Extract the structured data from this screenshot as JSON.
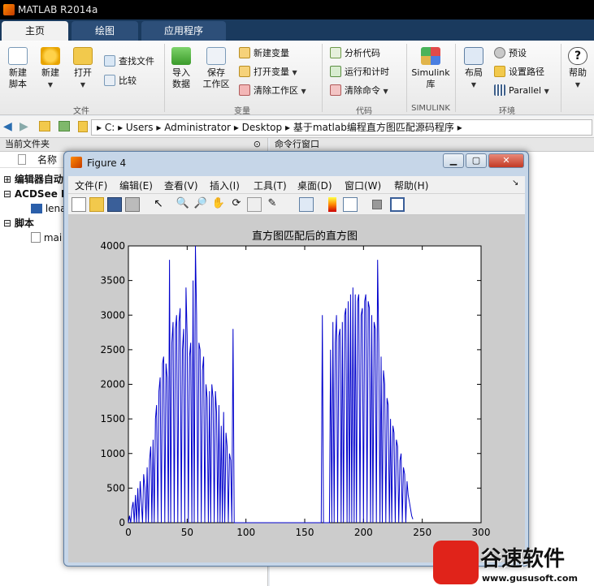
{
  "app": {
    "title": "MATLAB R2014a"
  },
  "tabs": [
    {
      "label": "主页"
    },
    {
      "label": "绘图"
    },
    {
      "label": "应用程序"
    }
  ],
  "ribbon": {
    "new_script": [
      "新建",
      "脚本"
    ],
    "new": "新建",
    "open": "打开",
    "find_files": "查找文件",
    "compare": "比较",
    "import_data": [
      "导入",
      "数据"
    ],
    "save_workspace": [
      "保存",
      "工作区"
    ],
    "new_variable": "新建变量",
    "open_variable": "打开变量",
    "clear_workspace": "清除工作区",
    "analyze_code": "分析代码",
    "run_and_time": "运行和计时",
    "clear_commands": "清除命令",
    "simulink": [
      "Simulink",
      "库"
    ],
    "layout": "布局",
    "preferences": "预设",
    "set_path": "设置路径",
    "parallel": "Parallel",
    "help": "帮助",
    "groups": {
      "file": "文件",
      "variable": "变量",
      "code": "代码",
      "simulink": "SIMULINK",
      "environment": "环境"
    }
  },
  "address": {
    "segments": [
      "C:",
      "Users",
      "Administrator",
      "Desktop",
      "基于matlab编程直方图匹配源码程序"
    ]
  },
  "left_panel": {
    "title": "当前文件夹",
    "column_name": "名称",
    "tree": [
      "编辑器自动",
      "ACDSee B",
      "lena",
      "脚本",
      "mai"
    ]
  },
  "right_panel": {
    "title": "命令行窗口"
  },
  "figure": {
    "title": "Figure 4",
    "menu": [
      "文件(F)",
      "编辑(E)",
      "查看(V)",
      "插入(I)",
      "工具(T)",
      "桌面(D)",
      "窗口(W)",
      "帮助(H)"
    ]
  },
  "chart_data": {
    "type": "line",
    "title": "直方图匹配后的直方图",
    "xlabel": "",
    "ylabel": "",
    "xlim": [
      0,
      300
    ],
    "ylim": [
      0,
      4000
    ],
    "xticks": [
      0,
      50,
      100,
      150,
      200,
      250,
      300
    ],
    "yticks": [
      0,
      500,
      1000,
      1500,
      2000,
      2500,
      3000,
      3500,
      4000
    ],
    "color": "#0000cc",
    "x": [
      0,
      1,
      2,
      3,
      4,
      5,
      6,
      7,
      8,
      9,
      10,
      11,
      12,
      13,
      14,
      15,
      16,
      17,
      18,
      19,
      20,
      21,
      22,
      23,
      24,
      25,
      26,
      27,
      28,
      29,
      30,
      31,
      32,
      33,
      34,
      35,
      36,
      37,
      38,
      39,
      40,
      41,
      42,
      43,
      44,
      45,
      46,
      47,
      48,
      49,
      50,
      51,
      52,
      53,
      54,
      55,
      56,
      57,
      58,
      59,
      60,
      61,
      62,
      63,
      64,
      65,
      66,
      67,
      68,
      69,
      70,
      71,
      72,
      73,
      74,
      75,
      76,
      77,
      78,
      79,
      80,
      81,
      82,
      83,
      84,
      85,
      86,
      87,
      88,
      89,
      90,
      91,
      92,
      93,
      94,
      95,
      96,
      97,
      98,
      99,
      100,
      101,
      102,
      103,
      104,
      105,
      106,
      107,
      108,
      109,
      110,
      111,
      112,
      113,
      114,
      115,
      116,
      117,
      118,
      119,
      120,
      121,
      122,
      123,
      124,
      125,
      126,
      127,
      128,
      129,
      130,
      131,
      132,
      133,
      134,
      135,
      136,
      137,
      138,
      139,
      140,
      141,
      142,
      143,
      144,
      145,
      146,
      147,
      148,
      149,
      150,
      151,
      152,
      153,
      154,
      155,
      156,
      157,
      158,
      159,
      160,
      161,
      162,
      163,
      164,
      165,
      166,
      167,
      168,
      169,
      170,
      171,
      172,
      173,
      174,
      175,
      176,
      177,
      178,
      179,
      180,
      181,
      182,
      183,
      184,
      185,
      186,
      187,
      188,
      189,
      190,
      191,
      192,
      193,
      194,
      195,
      196,
      197,
      198,
      199,
      200,
      201,
      202,
      203,
      204,
      205,
      206,
      207,
      208,
      209,
      210,
      211,
      212,
      213,
      214,
      215,
      216,
      217,
      218,
      219,
      220,
      221,
      222,
      223,
      224,
      225,
      226,
      227,
      228,
      229,
      230,
      231,
      232,
      233,
      234,
      235,
      236,
      237,
      238,
      239,
      240,
      241,
      242,
      243,
      244,
      245,
      246,
      247,
      248,
      249,
      250,
      251,
      252,
      253,
      254,
      255,
      256,
      257
    ],
    "y": [
      0,
      100,
      0,
      200,
      300,
      0,
      400,
      0,
      500,
      0,
      600,
      300,
      0,
      700,
      500,
      0,
      800,
      0,
      900,
      1100,
      0,
      1200,
      0,
      1500,
      1700,
      0,
      1900,
      2100,
      0,
      2300,
      2400,
      0,
      2300,
      2100,
      0,
      3800,
      0,
      2600,
      2900,
      0,
      2800,
      3000,
      0,
      2900,
      3100,
      0,
      2500,
      2800,
      0,
      3400,
      2700,
      0,
      2400,
      2600,
      0,
      3500,
      0,
      4000,
      3000,
      0,
      2600,
      2500,
      0,
      2200,
      2400,
      0,
      2000,
      1800,
      0,
      1900,
      0,
      2000,
      1800,
      0,
      1900,
      1600,
      0,
      1700,
      0,
      1400,
      0,
      1600,
      0,
      1300,
      1100,
      0,
      1000,
      900,
      0,
      2800,
      0,
      0,
      0,
      0,
      0,
      0,
      0,
      0,
      0,
      0,
      0,
      0,
      0,
      0,
      0,
      0,
      0,
      0,
      0,
      0,
      0,
      0,
      0,
      0,
      0,
      0,
      0,
      0,
      0,
      0,
      0,
      0,
      0,
      0,
      0,
      0,
      0,
      0,
      0,
      0,
      0,
      0,
      0,
      0,
      0,
      0,
      0,
      0,
      0,
      0,
      0,
      0,
      0,
      0,
      0,
      0,
      0,
      0,
      0,
      0,
      0,
      0,
      0,
      0,
      0,
      0,
      0,
      0,
      0,
      0,
      0,
      0,
      0,
      0,
      0,
      3000,
      0,
      0,
      0,
      0,
      0,
      0,
      2500,
      0,
      2900,
      0,
      2600,
      3000,
      0,
      2700,
      2800,
      0,
      2900,
      0,
      3000,
      3100,
      0,
      3200,
      0,
      3300,
      0,
      3400,
      0,
      3300,
      0,
      3200,
      3300,
      0,
      3000,
      3100,
      0,
      3200,
      3300,
      0,
      3200,
      3100,
      0,
      3000,
      0,
      2900,
      2800,
      0,
      3800,
      2600,
      0,
      2400,
      0,
      2200,
      2000,
      0,
      1800,
      1700,
      0,
      1500,
      0,
      1400,
      1300,
      0,
      1200,
      1100,
      0,
      900,
      1000,
      0,
      800,
      700,
      0,
      600,
      400,
      300,
      200,
      100,
      50
    ],
    "line_mode": "drop-to-zero"
  },
  "watermark": {
    "brand": "谷速软件",
    "url": "www.gususoft.com"
  }
}
